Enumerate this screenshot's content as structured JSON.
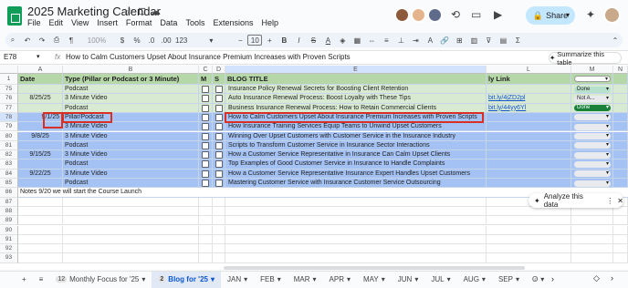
{
  "app": {
    "title": "2025 Marketing Calendar",
    "menu": [
      "File",
      "Edit",
      "View",
      "Insert",
      "Format",
      "Data",
      "Tools",
      "Extensions",
      "Help"
    ],
    "share_label": "Share"
  },
  "toolbar": {
    "zoom": "100%",
    "currency": "$",
    "percent": "%",
    "dec_minus": ".0",
    "dec_plus": ".00",
    "format123": "123",
    "font_size": "10"
  },
  "formula": {
    "cell_ref": "E78",
    "fx": "fx",
    "value": "How to Calm Customers Upset About Insurance Premium Increases with Proven Scripts",
    "summarize": "Summarize this table"
  },
  "columns": {
    "A": "A",
    "B": "B",
    "C": "C",
    "D": "D",
    "E": "E",
    "L": "L",
    "M": "M",
    "N": "N"
  },
  "header_row": {
    "num": "1",
    "date": "Date",
    "type": "Type (Pillar or Podcast or 3 Minute)",
    "m": "M",
    "s": "S",
    "blog": "BLOG TITLE",
    "link": "ly Link",
    "status": ""
  },
  "rows": [
    {
      "num": "75",
      "date": "",
      "type": "Podcast",
      "title": "Insurance Policy Renewal Secrets for Boosting Client Retention",
      "link": "",
      "status": "Done",
      "status_color": "#b7e1cd"
    },
    {
      "num": "76",
      "date": "8/25/25",
      "type": "3 Minute Video",
      "title": "Auto Insurance Renewal Process: Boost Loyalty with These Tips",
      "link": "bit.ly/4jZD2pl",
      "status": "Not A...",
      "status_color": "#e8eaed"
    },
    {
      "num": "77",
      "date": "",
      "type": "Podcast",
      "title": "Business Insurance Renewal Process: How to Retain Commercial Clients",
      "link": "bit.ly/44yy6Yl",
      "status": "Done",
      "status_color": "#188038"
    },
    {
      "num": "78",
      "date": "9/1/25",
      "type": "Pillar/Podcast",
      "title": "How to Calm Customers Upset About Insurance Premium Increases with Proven Scripts",
      "link": "",
      "status": "",
      "status_color": "#e8eaed"
    },
    {
      "num": "79",
      "date": "",
      "type": "3 Minute Video",
      "title": "How Insurance Training Services Equip Teams to Unwind Upset Customers",
      "link": "",
      "status": "",
      "status_color": "#e8eaed"
    },
    {
      "num": "80",
      "date": "9/8/25",
      "type": "3 Minute Video",
      "title": "Winning Over Upset Customers with Customer Service in the Insurance Industry",
      "link": "",
      "status": "",
      "status_color": "#e8eaed"
    },
    {
      "num": "81",
      "date": "",
      "type": "Podcast",
      "title": "Scripts to Transform Customer Service in Insurance Sector Interactions",
      "link": "",
      "status": "",
      "status_color": "#e8eaed"
    },
    {
      "num": "82",
      "date": "9/15/25",
      "type": "3 Minute Video",
      "title": "How a Customer Service Representative in Insurance Can Calm Upset Clients",
      "link": "",
      "status": "",
      "status_color": "#e8eaed"
    },
    {
      "num": "83",
      "date": "",
      "type": "Podcast",
      "title": "Top Examples of Good Customer Service in Insurance to Handle Complaints",
      "link": "",
      "status": "",
      "status_color": "#e8eaed"
    },
    {
      "num": "84",
      "date": "9/22/25",
      "type": "3 Minute Video",
      "title": "How a Customer Service Representative Insurance Expert Handles Upset Customers",
      "link": "",
      "status": "",
      "status_color": "#e8eaed"
    },
    {
      "num": "85",
      "date": "",
      "type": "Podcast",
      "title": "Mastering Customer Service with Insurance Customer Service Outsourcing",
      "link": "",
      "status": "",
      "status_color": "#e8eaed"
    }
  ],
  "notes_row": {
    "num": "86",
    "text": "Notes 9/20 we will start the Course Launch"
  },
  "empty_rows": [
    "87",
    "88",
    "89",
    "90",
    "91",
    "92",
    "93"
  ],
  "analyze": {
    "label": "Analyze this data"
  },
  "tabs": [
    {
      "label": "Monthly Focus for '25",
      "count": "12",
      "active": false
    },
    {
      "label": "Blog for '25",
      "count": "2",
      "active": true
    },
    {
      "label": "JAN",
      "count": "",
      "active": false
    },
    {
      "label": "FEB",
      "count": "",
      "active": false
    },
    {
      "label": "MAR",
      "count": "",
      "active": false
    },
    {
      "label": "APR",
      "count": "",
      "active": false
    },
    {
      "label": "MAY",
      "count": "",
      "active": false
    },
    {
      "label": "JUN",
      "count": "",
      "active": false
    },
    {
      "label": "JUL",
      "count": "",
      "active": false
    },
    {
      "label": "AUG",
      "count": "",
      "active": false
    },
    {
      "label": "SEP",
      "count": "",
      "active": false
    },
    {
      "label": "O",
      "count": "",
      "active": false
    }
  ],
  "colors": {
    "green_row": "#d9ead3",
    "blue_row": "#a4c2f4",
    "header_row": "#b6d7a8",
    "accent": "#0b57d0"
  }
}
